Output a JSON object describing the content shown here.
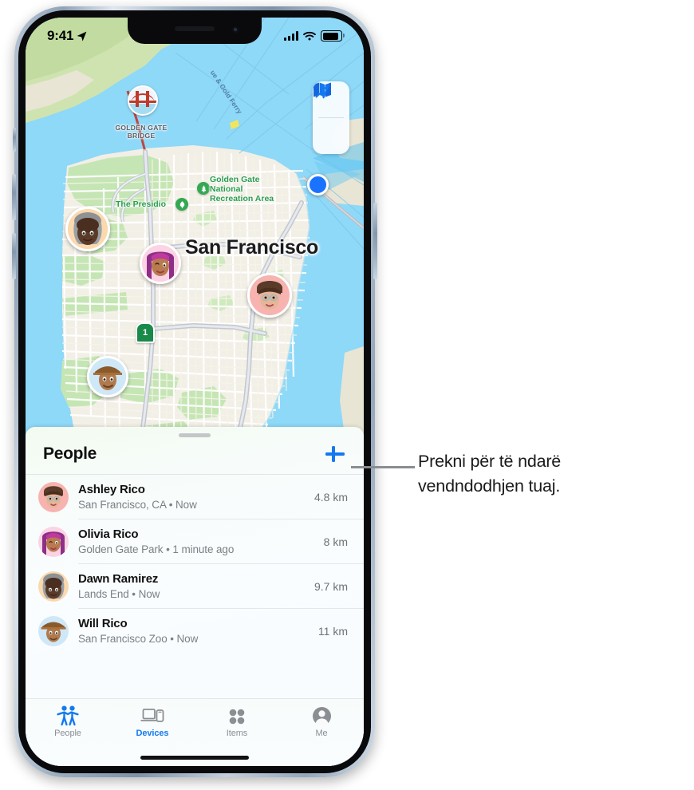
{
  "status_bar": {
    "time": "9:41",
    "location_arrow_icon": "location-arrow-icon",
    "cellular_icon": "cellular-bars-icon",
    "wifi_icon": "wifi-icon",
    "battery_icon": "battery-icon"
  },
  "map": {
    "city_label": "San Francisco",
    "labels": {
      "golden_gate_bridge": "GOLDEN GATE\nBRIDGE",
      "golden_gate_bridge_line1": "GOLDEN GATE",
      "golden_gate_bridge_line2": "BRIDGE",
      "ggnra_line1": "Golden Gate",
      "ggnra_line2": "National",
      "ggnra_line3": "Recreation Area",
      "presidio": "The Presidio",
      "ferry_route": "ue & Gold Ferry",
      "highway_shield": "1"
    },
    "controls": {
      "map_mode_label": "map-stack-icon",
      "locate_label": "locate-arrow-icon"
    },
    "colors": {
      "water": "#8ed8f8",
      "land": "#f2efe6",
      "park": "#c5e6b4",
      "road": "#ffffff",
      "highway": "#cfd3d9",
      "user_dot": "#1a73ff",
      "accent": "#1479f0"
    }
  },
  "sheet": {
    "title": "People",
    "add_button_label": "add-person-button",
    "people": [
      {
        "name": "Ashley Rico",
        "subtitle": "San Francisco, CA • Now",
        "distance": "4.8 km",
        "avatar": "ashley"
      },
      {
        "name": "Olivia Rico",
        "subtitle": "Golden Gate Park • 1 minute ago",
        "distance": "8 km",
        "avatar": "olivia"
      },
      {
        "name": "Dawn Ramirez",
        "subtitle": "Lands End • Now",
        "distance": "9.7 km",
        "avatar": "dawn"
      },
      {
        "name": "Will Rico",
        "subtitle": "San Francisco Zoo • Now",
        "distance": "11 km",
        "avatar": "will"
      }
    ]
  },
  "tab_bar": {
    "tabs": [
      {
        "label": "People",
        "icon": "people-icon",
        "state": "icon-active"
      },
      {
        "label": "Devices",
        "icon": "devices-icon",
        "state": "label-active"
      },
      {
        "label": "Items",
        "icon": "items-icon",
        "state": "inactive"
      },
      {
        "label": "Me",
        "icon": "person-circle-icon",
        "state": "inactive"
      }
    ]
  },
  "callout": {
    "text": "Prekni për të ndarë vendndodhjen tuaj.",
    "line1": "Prekni për të ndarë",
    "line2": "vendndodhjen tuaj."
  }
}
